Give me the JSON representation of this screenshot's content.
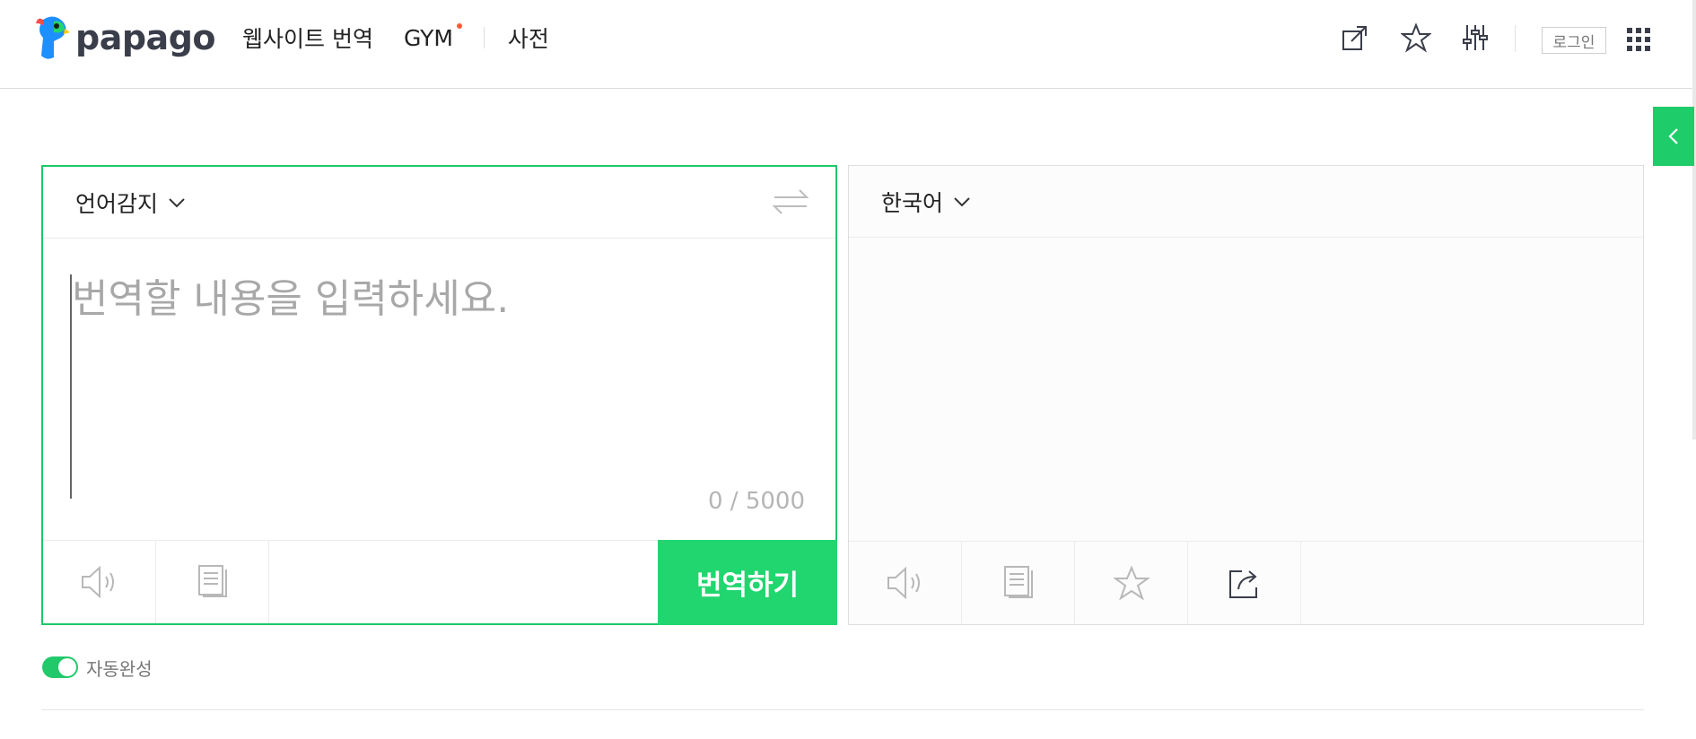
{
  "header": {
    "logo_text": "papago",
    "nav": [
      {
        "label": "웹사이트 번역"
      },
      {
        "label": "GYM",
        "has_dot": true
      },
      {
        "label": "사전"
      }
    ],
    "icons": [
      "open-external-icon",
      "star-icon",
      "settings-sliders-icon"
    ],
    "login_label": "로그인",
    "apps_icon": "grid-apps-icon"
  },
  "source": {
    "language": "언어감지",
    "placeholder": "번역할 내용을 입력하세요.",
    "char_count": "0 / 5000",
    "translate_label": "번역하기"
  },
  "target": {
    "language": "한국어"
  },
  "autocomplete": {
    "label": "자동완성",
    "enabled": true
  },
  "colors": {
    "accent": "#22d66f",
    "border_active": "#1ec86a"
  }
}
